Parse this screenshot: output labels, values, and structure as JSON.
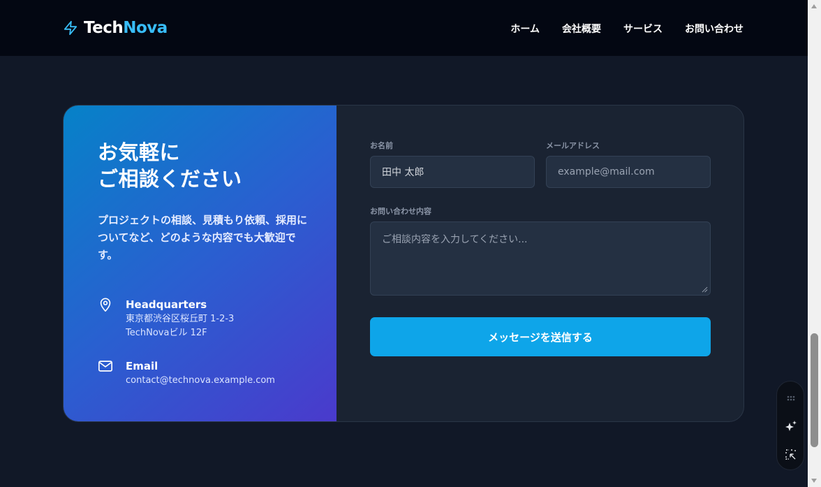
{
  "brand": {
    "prefix": "Tech",
    "suffix": "Nova"
  },
  "nav": {
    "items": [
      "ホーム",
      "会社概要",
      "サービス",
      "お問い合わせ"
    ]
  },
  "contact": {
    "heading_line1": "お気軽に",
    "heading_line2": "ご相談ください",
    "intro": "プロジェクトの相談、見積もり依頼、採用についてなど、どのような内容でも大歓迎です。",
    "hq": {
      "title": "Headquarters",
      "line1": "東京都渋谷区桜丘町 1-2-3",
      "line2": "TechNovaビル 12F"
    },
    "email": {
      "title": "Email",
      "value": "contact@technova.example.com"
    }
  },
  "form": {
    "name_label": "お名前",
    "name_value": "田中 太郎",
    "email_label": "メールアドレス",
    "email_placeholder": "example@mail.com",
    "message_label": "お問い合わせ内容",
    "message_placeholder": "ご相談内容を入力してください...",
    "submit_label": "メッセージを送信する"
  },
  "colors": {
    "accent": "#38bdf8",
    "button": "#0ea5e9",
    "background": "#111827",
    "header": "#030712"
  },
  "floating_toolbar": {
    "icons": [
      "drag-handle-icon",
      "sparkle-icon",
      "select-region-icon"
    ]
  }
}
